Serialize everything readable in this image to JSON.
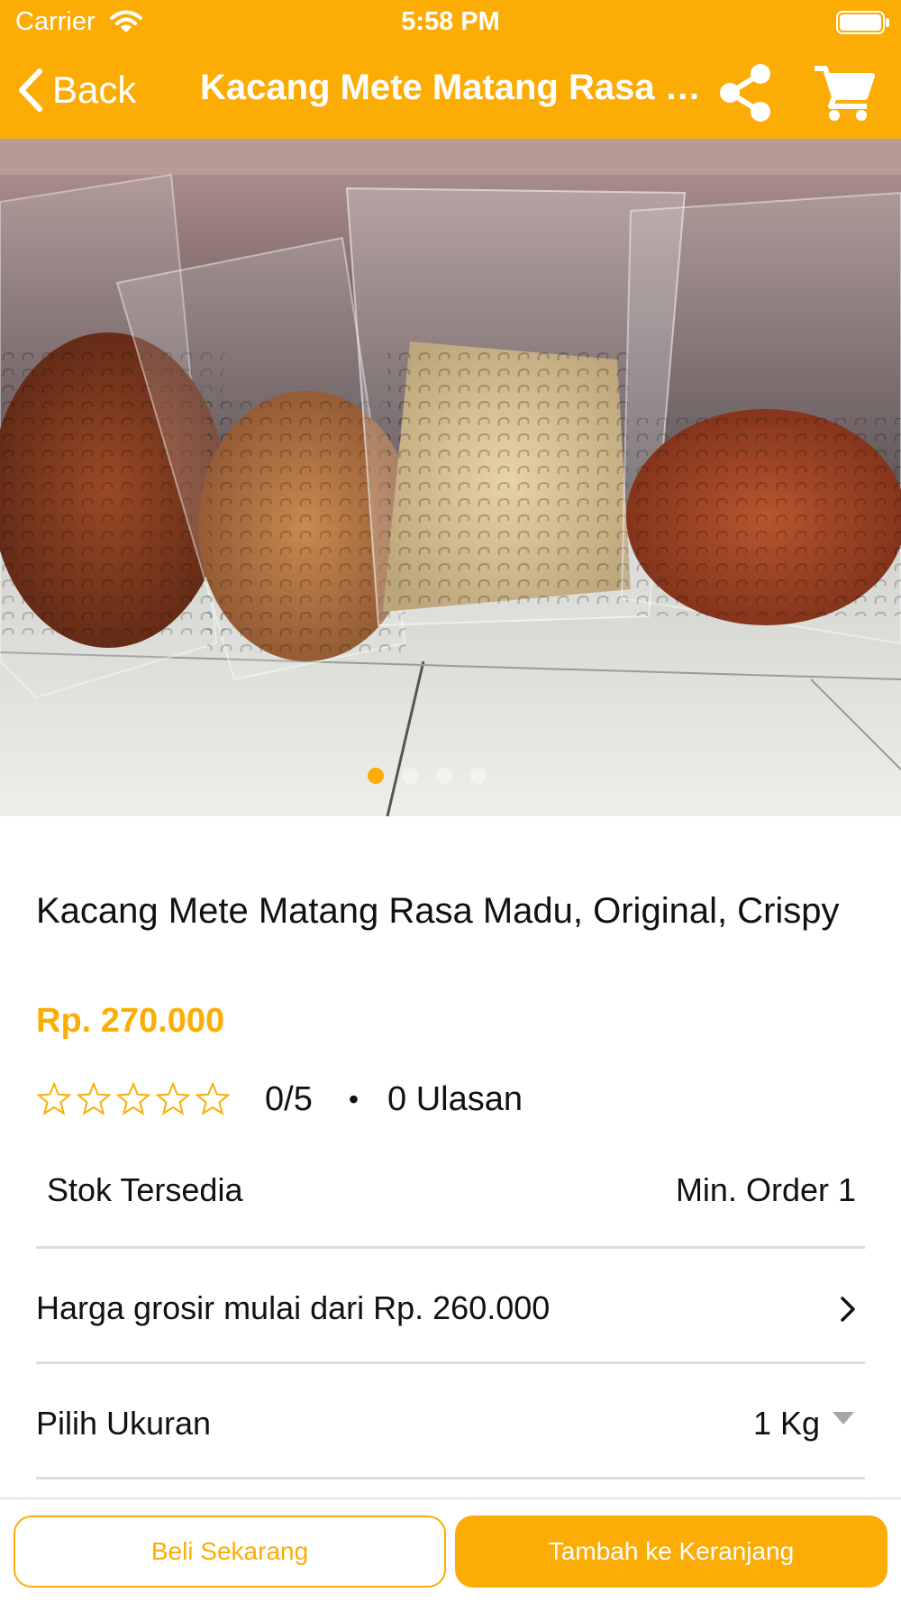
{
  "status_bar": {
    "carrier": "Carrier",
    "time": "5:58 PM",
    "wifi_icon": "wifi-icon",
    "battery_icon": "battery-icon"
  },
  "nav": {
    "back_label": "Back",
    "title": "Kacang Mete Matang Rasa Madu, Original, Crispy",
    "share_icon": "share-icon",
    "cart_icon": "cart-icon"
  },
  "carousel": {
    "image_icon": "product-photo",
    "page_count": 4,
    "active_page": 1
  },
  "product": {
    "title": "Kacang Mete Matang Rasa Madu, Original, Crispy",
    "price": "Rp. 270.000",
    "rating": "0/5",
    "rating_value": 0,
    "rating_max": 5,
    "separator": "•",
    "reviews": "0 Ulasan",
    "stock": "Stok Tersedia",
    "min_order": "Min. Order 1",
    "wholesale": "Harga grosir mulai dari Rp. 260.000",
    "size_label": "Pilih Ukuran",
    "size_value": "1 Kg"
  },
  "actions": {
    "buy_now": "Beli Sekarang",
    "add_to_cart": "Tambah ke Keranjang"
  },
  "colors": {
    "accent": "#fbad05",
    "text": "#111111",
    "divider": "#dcdcdc"
  }
}
